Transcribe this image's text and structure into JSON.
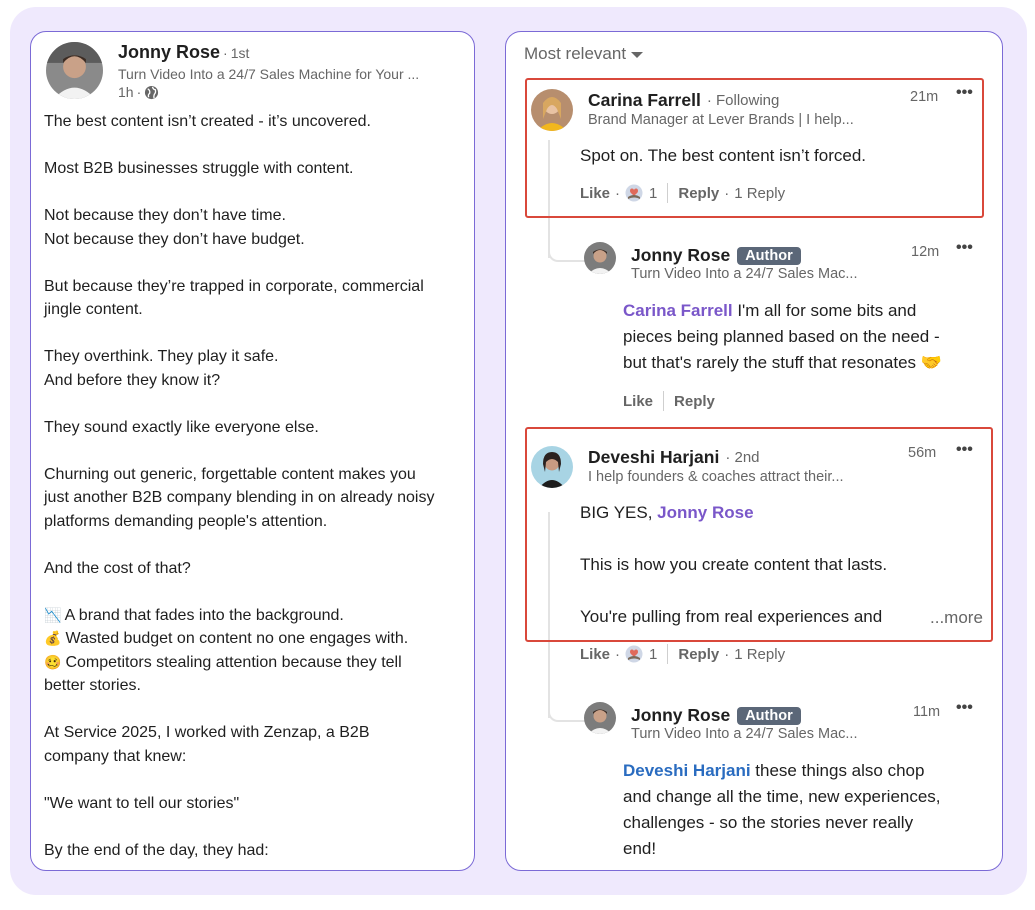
{
  "post": {
    "author": "Jonny Rose",
    "degree": "1st",
    "headline": "Turn Video Into a 24/7 Sales Machine for Your ...",
    "time": "1h",
    "visibility_icon": "globe-icon",
    "paragraphs": [
      [
        "The best content isn’t created - it’s uncovered."
      ],
      [
        "Most B2B businesses struggle with content."
      ],
      [
        "Not because they don’t have time.",
        "Not because they don’t have budget."
      ],
      [
        "But because they’re trapped in corporate, commercial",
        "jingle content."
      ],
      [
        "They overthink. They play it safe.",
        "And before they know it?"
      ],
      [
        "They sound exactly like everyone else."
      ],
      [
        "Churning out generic, forgettable content makes you",
        "just another B2B company blending in on already noisy",
        "platforms demanding people's attention."
      ],
      [
        "And the cost of that?"
      ]
    ],
    "bullets": [
      {
        "emoji": "📉",
        "text": "A brand that fades into the background."
      },
      {
        "emoji": "💰",
        "text": "Wasted budget on content no one engages with."
      },
      {
        "emoji": "🥴",
        "text": "Competitors stealing attention because they tell",
        "cont": "better stories."
      }
    ],
    "closing": [
      [
        "At Service 2025, I worked with Zenzap, a B2B",
        "company that knew:"
      ],
      [
        "\"We want to tell our stories\""
      ],
      [
        "By the end of the day, they had:"
      ]
    ]
  },
  "comments_panel": {
    "sort_label": "Most relevant",
    "comments": [
      {
        "name": "Carina Farrell",
        "relation": "· Following",
        "headline": "Brand Manager at Lever Brands | I help...",
        "time": "21m",
        "text": "Spot on. The best content isn’t forced.",
        "like_label": "Like",
        "reaction_count": "1",
        "reply_label": "Reply",
        "replies_count": "1 Reply"
      },
      {
        "name": "Jonny Rose",
        "badge": "Author",
        "headline": "Turn Video Into a 24/7 Sales Mac...",
        "time": "12m",
        "mention": "Carina Farrell",
        "text_lines": [
          " I'm all for some bits and",
          "pieces being planned based on the need -",
          "but that's rarely the stuff that resonates 🤝"
        ],
        "like_label": "Like",
        "reply_label": "Reply"
      },
      {
        "name": "Deveshi Harjani",
        "relation": "· 2nd",
        "headline": "I help founders & coaches attract their...",
        "time": "56m",
        "text_prefix": "BIG YES, ",
        "mention": "Jonny Rose",
        "line2": "This is how you create content that lasts.",
        "line3": "You're pulling from real experiences and",
        "more_label": "...more",
        "like_label": "Like",
        "reaction_count": "1",
        "reply_label": "Reply",
        "replies_count": "1 Reply"
      },
      {
        "name": "Jonny Rose",
        "badge": "Author",
        "headline": "Turn Video Into a 24/7 Sales Mac...",
        "time": "11m",
        "mention": "Deveshi Harjani",
        "text_lines": [
          " these things also chop",
          "and change all the time, new experiences,",
          "challenges - so the stories never really",
          "end!"
        ]
      }
    ]
  },
  "colors": {
    "frame_bg": "#efe9fd",
    "panel_border": "#7b6ad6",
    "highlight_red": "#d9483b",
    "mention_purple": "#7a57c9",
    "mention_blue": "#2a6cc0",
    "author_badge": "#5b6778"
  }
}
